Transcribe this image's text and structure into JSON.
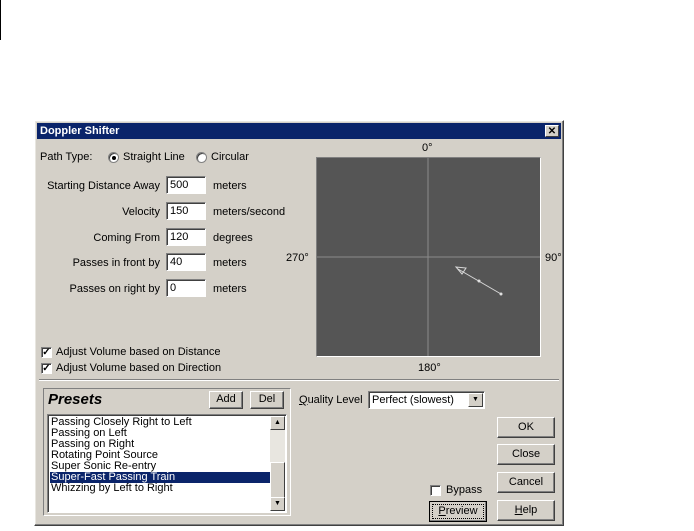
{
  "window": {
    "title": "Doppler Shifter",
    "close_glyph": "✕"
  },
  "path_type": {
    "label": "Path Type:",
    "options": [
      {
        "label": "Straight Line",
        "selected": true
      },
      {
        "label": "Circular",
        "selected": false
      }
    ]
  },
  "params": [
    {
      "label": "Starting Distance Away",
      "value": "500",
      "unit": "meters"
    },
    {
      "label": "Velocity",
      "value": "150",
      "unit": "meters/second"
    },
    {
      "label": "Coming From",
      "value": "120",
      "unit": "degrees"
    },
    {
      "label": "Passes in front by",
      "value": "40",
      "unit": "meters"
    },
    {
      "label": "Passes on right by",
      "value": "0",
      "unit": "meters"
    }
  ],
  "checks": [
    {
      "label": "Adjust Volume based on Distance",
      "checked": true
    },
    {
      "label": "Adjust Volume based on Direction",
      "checked": true
    }
  ],
  "compass": {
    "top": "0°",
    "right": "90°",
    "bottom": "180°",
    "left": "270°"
  },
  "presets": {
    "title": "Presets",
    "add_label": "Add",
    "del_label": "Del",
    "items": [
      "Passing Closely Right to Left",
      "Passing on Left",
      "Passing on Right",
      "Rotating Point Source",
      "Super Sonic Re-entry",
      "Super-Fast Passing Train",
      "Whizzing by Left to Right"
    ],
    "selected_index": 5
  },
  "quality": {
    "label_pre": "",
    "label_u": "Q",
    "label_post": "uality Level",
    "value": "Perfect (slowest)"
  },
  "bypass": {
    "label": "Bypass",
    "checked": false
  },
  "buttons": {
    "ok": "OK",
    "close": "Close",
    "cancel": "Cancel",
    "preview_u": "P",
    "preview_rest": "review",
    "help_u": "H",
    "help_rest": "elp"
  },
  "colors": {
    "titlebar": "#0a246a",
    "dialog": "#d4d0c8",
    "radar_bg": "#555555",
    "selection": "#0a246a"
  }
}
